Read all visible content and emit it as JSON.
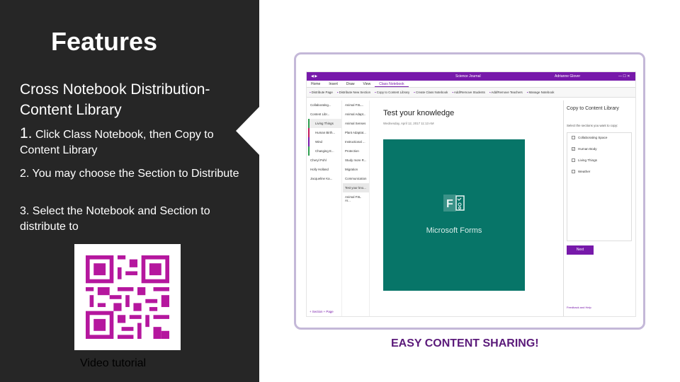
{
  "left": {
    "title": "Features",
    "heading": "Cross Notebook Distribution- Content Library",
    "step1_num": "1.",
    "step1_text": " Click Class Notebook, then Copy to Content Library",
    "step2": "2. You may choose the Section to Distribute",
    "step3": "3. Select the Notebook and Section to distribute to",
    "video_label": "Video tutorial",
    "qr_color": "#b5179e"
  },
  "screenshot": {
    "window_title": "Science Journal",
    "user": "Adrianne Glover",
    "tabs": [
      "Home",
      "Insert",
      "Draw",
      "View",
      "Class Notebook"
    ],
    "ribbon": [
      "Distribute Page",
      "Distribute New Section",
      "Copy to Content Library",
      "Create Class Notebook",
      "Add/Remove Students",
      "Add/Remove Teachers",
      "Manage Notebook"
    ],
    "sections": [
      "Collaborating...",
      "Content Libr...",
      "Living Things",
      "Human Birth...",
      "Wind",
      "Changing E...",
      "Cheryl Pohl",
      "Holly Holland",
      "Jacqueline Ka..."
    ],
    "pages": [
      "Animal FSL...",
      "Animal Adapt...",
      "Animal Senses",
      "Plant Adaptat...",
      "Instructional ...",
      "Protection",
      "Study more R...",
      "Migration",
      "Communication",
      "Test your kno...",
      "Animal FSL Ar..."
    ],
    "page_title": "Test your knowledge",
    "page_date": "Wednesday, April 12, 2017        11:13 AM",
    "forms_label": "Microsoft Forms",
    "copy_pane": {
      "title": "Copy to Content Library",
      "instruction": "Select the sections you want to copy:",
      "items": [
        {
          "label": "Collaborating Space",
          "checked": false
        },
        {
          "label": "Human Body",
          "checked": true
        },
        {
          "label": "Living Things",
          "checked": false
        },
        {
          "label": "Weather",
          "checked": false
        }
      ],
      "next": "Next",
      "footer": "Feedback and Help"
    },
    "bottom_links": "+ Section      + Page"
  },
  "caption": "EASY CONTENT SHARING!",
  "colors": {
    "accent": "#7719aa",
    "forms_green": "#077568",
    "dark": "#262626",
    "caption": "#5b1a7a"
  }
}
